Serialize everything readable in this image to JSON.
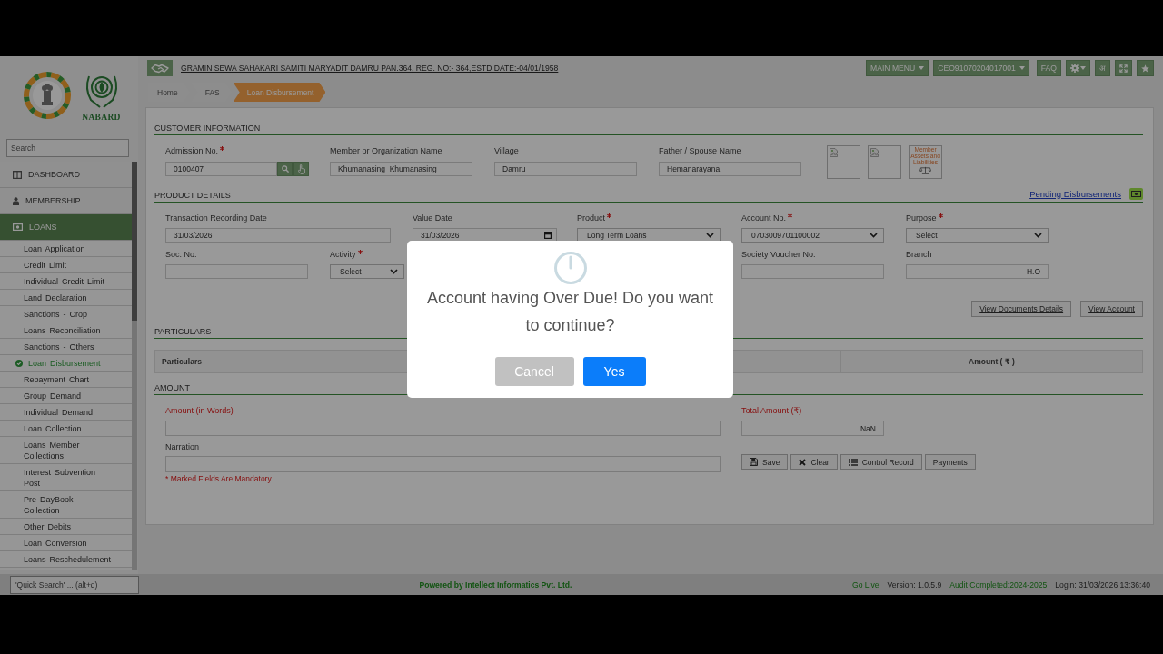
{
  "header": {
    "title": "GRAMIN SEWA SAHAKARI SAMITI MARYADIT DAMRU PAN.364, REG. NO:- 364,ESTD DATE:-04/01/1958",
    "menus": [
      {
        "label": "MAIN MENU"
      },
      {
        "label": "CEO91070204017001"
      }
    ],
    "faq": "FAQ",
    "language": "अ"
  },
  "logo": {
    "name": "NABARD"
  },
  "sidebar": {
    "search": {
      "placeholder": "Search"
    },
    "items": [
      {
        "label": "DASHBOARD",
        "selected": false
      },
      {
        "label": "MEMBERSHIP",
        "selected": false
      },
      {
        "label": "LOANS",
        "selected": true,
        "children": [
          {
            "label": "Loan Application",
            "selected": false
          },
          {
            "label": "Credit Limit",
            "selected": false
          },
          {
            "label": "Individual Credit Limit",
            "selected": false
          },
          {
            "label": "Land Declaration",
            "selected": false
          },
          {
            "label": "Sanctions - Crop",
            "selected": false
          },
          {
            "label": "Loans Reconciliation",
            "selected": false
          },
          {
            "label": "Sanctions - Others",
            "selected": false
          },
          {
            "label": "Loan Disbursement",
            "selected": true
          },
          {
            "label": "Repayment Chart",
            "selected": false
          },
          {
            "label": "Group Demand",
            "selected": false
          },
          {
            "label": "Individual Demand",
            "selected": false
          },
          {
            "label": "Loan Collection",
            "selected": false
          },
          {
            "label": "Loans Member Collections",
            "selected": false
          },
          {
            "label": "Interest Subvention Post",
            "selected": false
          },
          {
            "label": "Pre DayBook Collection",
            "selected": false
          },
          {
            "label": "Other Debits",
            "selected": false
          },
          {
            "label": "Loan Conversion",
            "selected": false
          },
          {
            "label": "Loans Reschedulement",
            "selected": false
          }
        ]
      }
    ]
  },
  "breadcrumb": [
    {
      "label": "Home",
      "selected": false
    },
    {
      "label": "FAS",
      "selected": false
    },
    {
      "label": "Loan Disbursement",
      "selected": true
    }
  ],
  "customer_information": {
    "title": "CUSTOMER INFORMATION",
    "fields": [
      {
        "label": "Admission No.",
        "required": true,
        "kind": "lookup",
        "value": "0100407"
      },
      {
        "label": "Member or Organization Name",
        "required": false,
        "kind": "text",
        "value": "Khumanasing  Khumanasing"
      },
      {
        "label": "Village",
        "required": false,
        "kind": "text",
        "value": "Damru"
      },
      {
        "label": "Father / Spouse Name",
        "required": false,
        "kind": "text",
        "value": "Hemanarayana"
      }
    ],
    "images": [
      {
        "kind": "broken"
      },
      {
        "kind": "broken"
      },
      {
        "kind": "assets",
        "caption": "Member Assets and Liabilities"
      }
    ]
  },
  "product_details": {
    "title": "PRODUCT DETAILS",
    "link": "Pending Disbursements",
    "fields": [
      {
        "label": "Transaction Recording Date",
        "required": false,
        "kind": "text",
        "value": "31/03/2026"
      },
      {
        "label": "Value Date",
        "required": false,
        "kind": "date",
        "value": "31/03/2026"
      },
      {
        "label": "Product",
        "required": true,
        "kind": "select",
        "value": "Long Term Loans"
      },
      {
        "label": "Account No.",
        "required": true,
        "kind": "select",
        "value": "0703009701100002"
      },
      {
        "label": "Purpose",
        "required": true,
        "kind": "select",
        "value": "Select"
      },
      {
        "label": "Soc. No.",
        "required": false,
        "kind": "text"
      },
      {
        "label": "Activity",
        "required": true,
        "kind": "select",
        "value": "Select"
      },
      {
        "label": "Society Voucher No.",
        "required": false,
        "kind": "text"
      },
      {
        "label": "Branch",
        "required": false,
        "kind": "display",
        "value": "H.O"
      }
    ],
    "buttons": [
      {
        "label": "View Documents Details"
      },
      {
        "label": "View Account"
      }
    ]
  },
  "particulars": {
    "title": "PARTICULARS",
    "columns": [
      "Particulars",
      "Amount ( ₹ )"
    ]
  },
  "amount": {
    "title": "AMOUNT",
    "rows": [
      [
        {
          "label": "Amount (in Words)",
          "alert": true,
          "kind": "text"
        },
        {
          "label": "Total Amount (₹)",
          "alert": true,
          "kind": "display",
          "value": "NaN"
        }
      ],
      [
        {
          "label": "Narration",
          "alert": false,
          "kind": "text"
        }
      ]
    ],
    "buttons": [
      {
        "label": "Save"
      },
      {
        "label": "Clear"
      },
      {
        "label": "Control Record"
      },
      {
        "label": "Payments"
      }
    ],
    "note": "* Marked Fields Are Mandatory"
  },
  "dialog": {
    "message": "Account having Over Due! Do you want to continue?",
    "buttons": [
      {
        "label": "Cancel",
        "kind": "cancel"
      },
      {
        "label": "Yes",
        "kind": "confirm"
      }
    ]
  },
  "status_bar": {
    "quick_search": {
      "placeholder": "'Quick Search' ... (alt+q)"
    },
    "powered_by": "Powered by Intellect Informatics Pvt. Ltd.",
    "items": [
      {
        "text": "Go Live",
        "kind": "status"
      },
      {
        "text": "Version: 1.0.5.9",
        "kind": "info"
      },
      {
        "text": "Audit Completed:2024-2025",
        "kind": "status"
      },
      {
        "text": "Login: 31/03/2026 13:36:40",
        "kind": "info"
      }
    ]
  }
}
